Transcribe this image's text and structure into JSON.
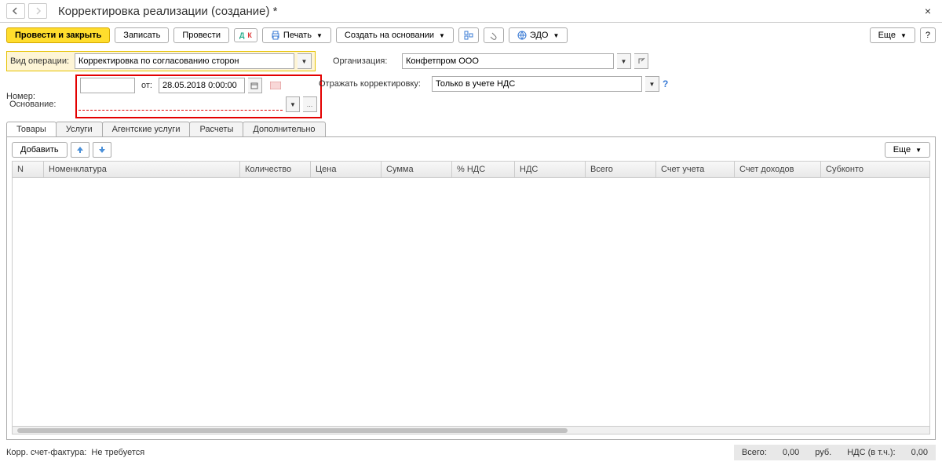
{
  "header": {
    "title": "Корректировка реализации (создание) *"
  },
  "toolbar": {
    "post_close": "Провести и закрыть",
    "save": "Записать",
    "post": "Провести",
    "print": "Печать",
    "create_based": "Создать на основании",
    "edo": "ЭДО",
    "more": "Еще"
  },
  "form": {
    "op_type_label": "Вид операции:",
    "op_type_value": "Корректировка по согласованию сторон",
    "org_label": "Организация:",
    "org_value": "Конфетпром ООО",
    "number_label": "Номер:",
    "number_value": "",
    "from_label": "от:",
    "date_value": "28.05.2018 0:00:00",
    "reflect_label": "Отражать корректировку:",
    "reflect_value": "Только в учете НДС",
    "basis_label": "Основание:",
    "basis_value": ""
  },
  "tabs": {
    "goods": "Товары",
    "services": "Услуги",
    "agent_services": "Агентские услуги",
    "calc": "Расчеты",
    "additional": "Дополнительно"
  },
  "grid_toolbar": {
    "add": "Добавить",
    "more": "Еще"
  },
  "columns": {
    "n": "N",
    "nomenclature": "Номенклатура",
    "qty": "Количество",
    "price": "Цена",
    "sum": "Сумма",
    "vat_pct": "% НДС",
    "vat": "НДС",
    "total": "Всего",
    "account": "Счет учета",
    "income_acc": "Счет доходов",
    "subconto": "Субконто"
  },
  "footer": {
    "corr_invoice_label": "Корр. счет-фактура:",
    "corr_invoice_value": "Не требуется",
    "total_label": "Всего:",
    "total_value": "0,00",
    "currency": "руб.",
    "vat_incl_label": "НДС (в т.ч.):",
    "vat_incl_value": "0,00"
  }
}
